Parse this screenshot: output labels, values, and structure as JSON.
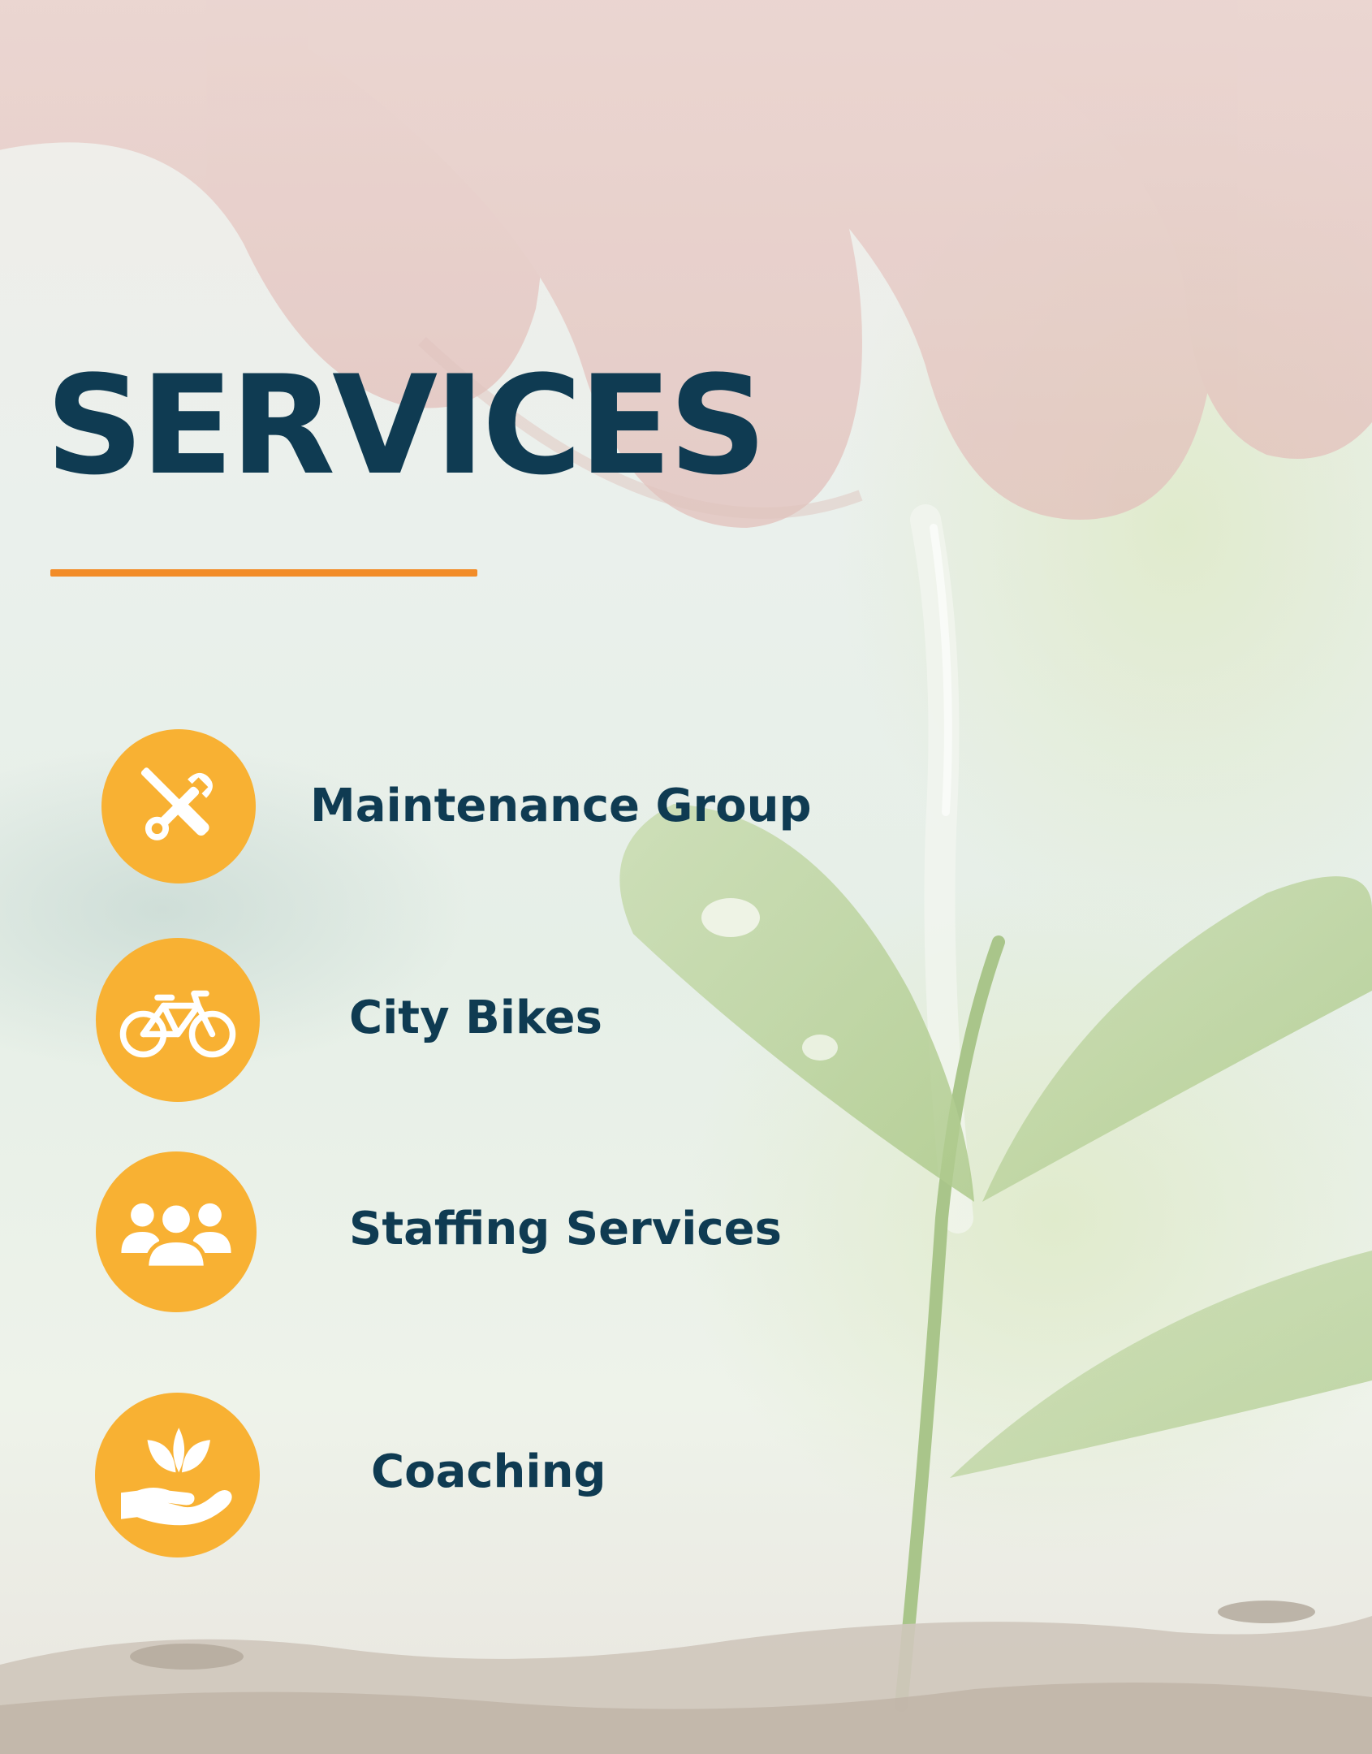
{
  "title": "SERVICES",
  "colors": {
    "title": "#0f3b52",
    "accent_rule": "#f28c28",
    "icon_badge": "#f8b133",
    "icon_glyph": "#ffffff"
  },
  "services": [
    {
      "label": "Maintenance Group",
      "icon": "wrench-screwdriver-icon"
    },
    {
      "label": "City Bikes",
      "icon": "bicycle-icon"
    },
    {
      "label": "Staffing Services",
      "icon": "people-group-icon"
    },
    {
      "label": "Coaching",
      "icon": "hand-leaves-icon"
    }
  ]
}
